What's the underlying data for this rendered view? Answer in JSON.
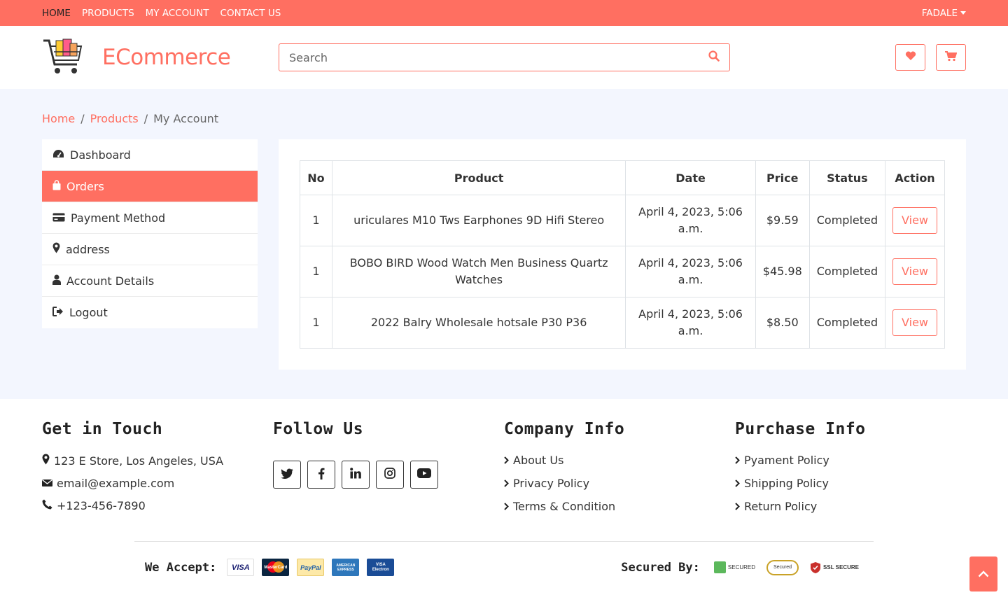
{
  "topbar": {
    "nav": [
      {
        "label": "HOME",
        "active": true
      },
      {
        "label": "PRODUCTS",
        "active": false
      },
      {
        "label": "MY ACCOUNT",
        "active": false
      },
      {
        "label": "CONTACT US",
        "active": false
      }
    ],
    "user": "FADALE"
  },
  "header": {
    "logo_text": "ECommerce",
    "search_placeholder": "Search"
  },
  "breadcrumb": [
    "Home",
    "Products",
    "My Account"
  ],
  "sidebar": {
    "items": [
      {
        "label": "Dashboard",
        "icon": "dashboard-icon",
        "active": false
      },
      {
        "label": "Orders",
        "icon": "shopping-bag-icon",
        "active": true
      },
      {
        "label": "Payment Method",
        "icon": "credit-card-icon",
        "active": false
      },
      {
        "label": "address",
        "icon": "map-marker-icon",
        "active": false
      },
      {
        "label": "Account Details",
        "icon": "user-icon",
        "active": false
      },
      {
        "label": "Logout",
        "icon": "sign-out-icon",
        "active": false
      }
    ]
  },
  "orders": {
    "columns": [
      "No",
      "Product",
      "Date",
      "Price",
      "Status",
      "Action"
    ],
    "rows": [
      {
        "no": "1",
        "product": "uriculares M10 Tws Earphones 9D Hifi Stereo",
        "date": "April 4, 2023, 5:06 a.m.",
        "price": "$9.59",
        "status": "Completed",
        "action": "View"
      },
      {
        "no": "1",
        "product": "BOBO BIRD Wood Watch Men Business Quartz Watches",
        "date": "April 4, 2023, 5:06 a.m.",
        "price": "$45.98",
        "status": "Completed",
        "action": "View"
      },
      {
        "no": "1",
        "product": "2022 Balry Wholesale hotsale P30 P36",
        "date": "April 4, 2023, 5:06 a.m.",
        "price": "$8.50",
        "status": "Completed",
        "action": "View"
      }
    ]
  },
  "footer": {
    "get_in_touch": {
      "title": "Get in Touch",
      "address": "123 E Store, Los Angeles, USA",
      "email": "email@example.com",
      "phone": "+123-456-7890"
    },
    "follow_us": {
      "title": "Follow Us",
      "icons": [
        "twitter-icon",
        "facebook-icon",
        "linkedin-icon",
        "instagram-icon",
        "youtube-icon"
      ]
    },
    "company_info": {
      "title": "Company Info",
      "links": [
        "About Us",
        "Privacy Policy",
        "Terms & Condition"
      ]
    },
    "purchase_info": {
      "title": "Purchase Info",
      "links": [
        "Pyament Policy",
        "Shipping Policy",
        "Return Policy"
      ]
    },
    "we_accept": {
      "label": "We Accept:",
      "cards": [
        "VISA",
        "MasterCard",
        "PayPal",
        "AMERICAN EXPRESS",
        "VISA Electron"
      ]
    },
    "secured_by": {
      "label": "Secured By:",
      "badges": [
        "SECURED",
        "Secured",
        "SSL SECURE"
      ]
    }
  },
  "colors": {
    "accent": "#ff6f61",
    "page_bg": "#f3f6fe"
  }
}
